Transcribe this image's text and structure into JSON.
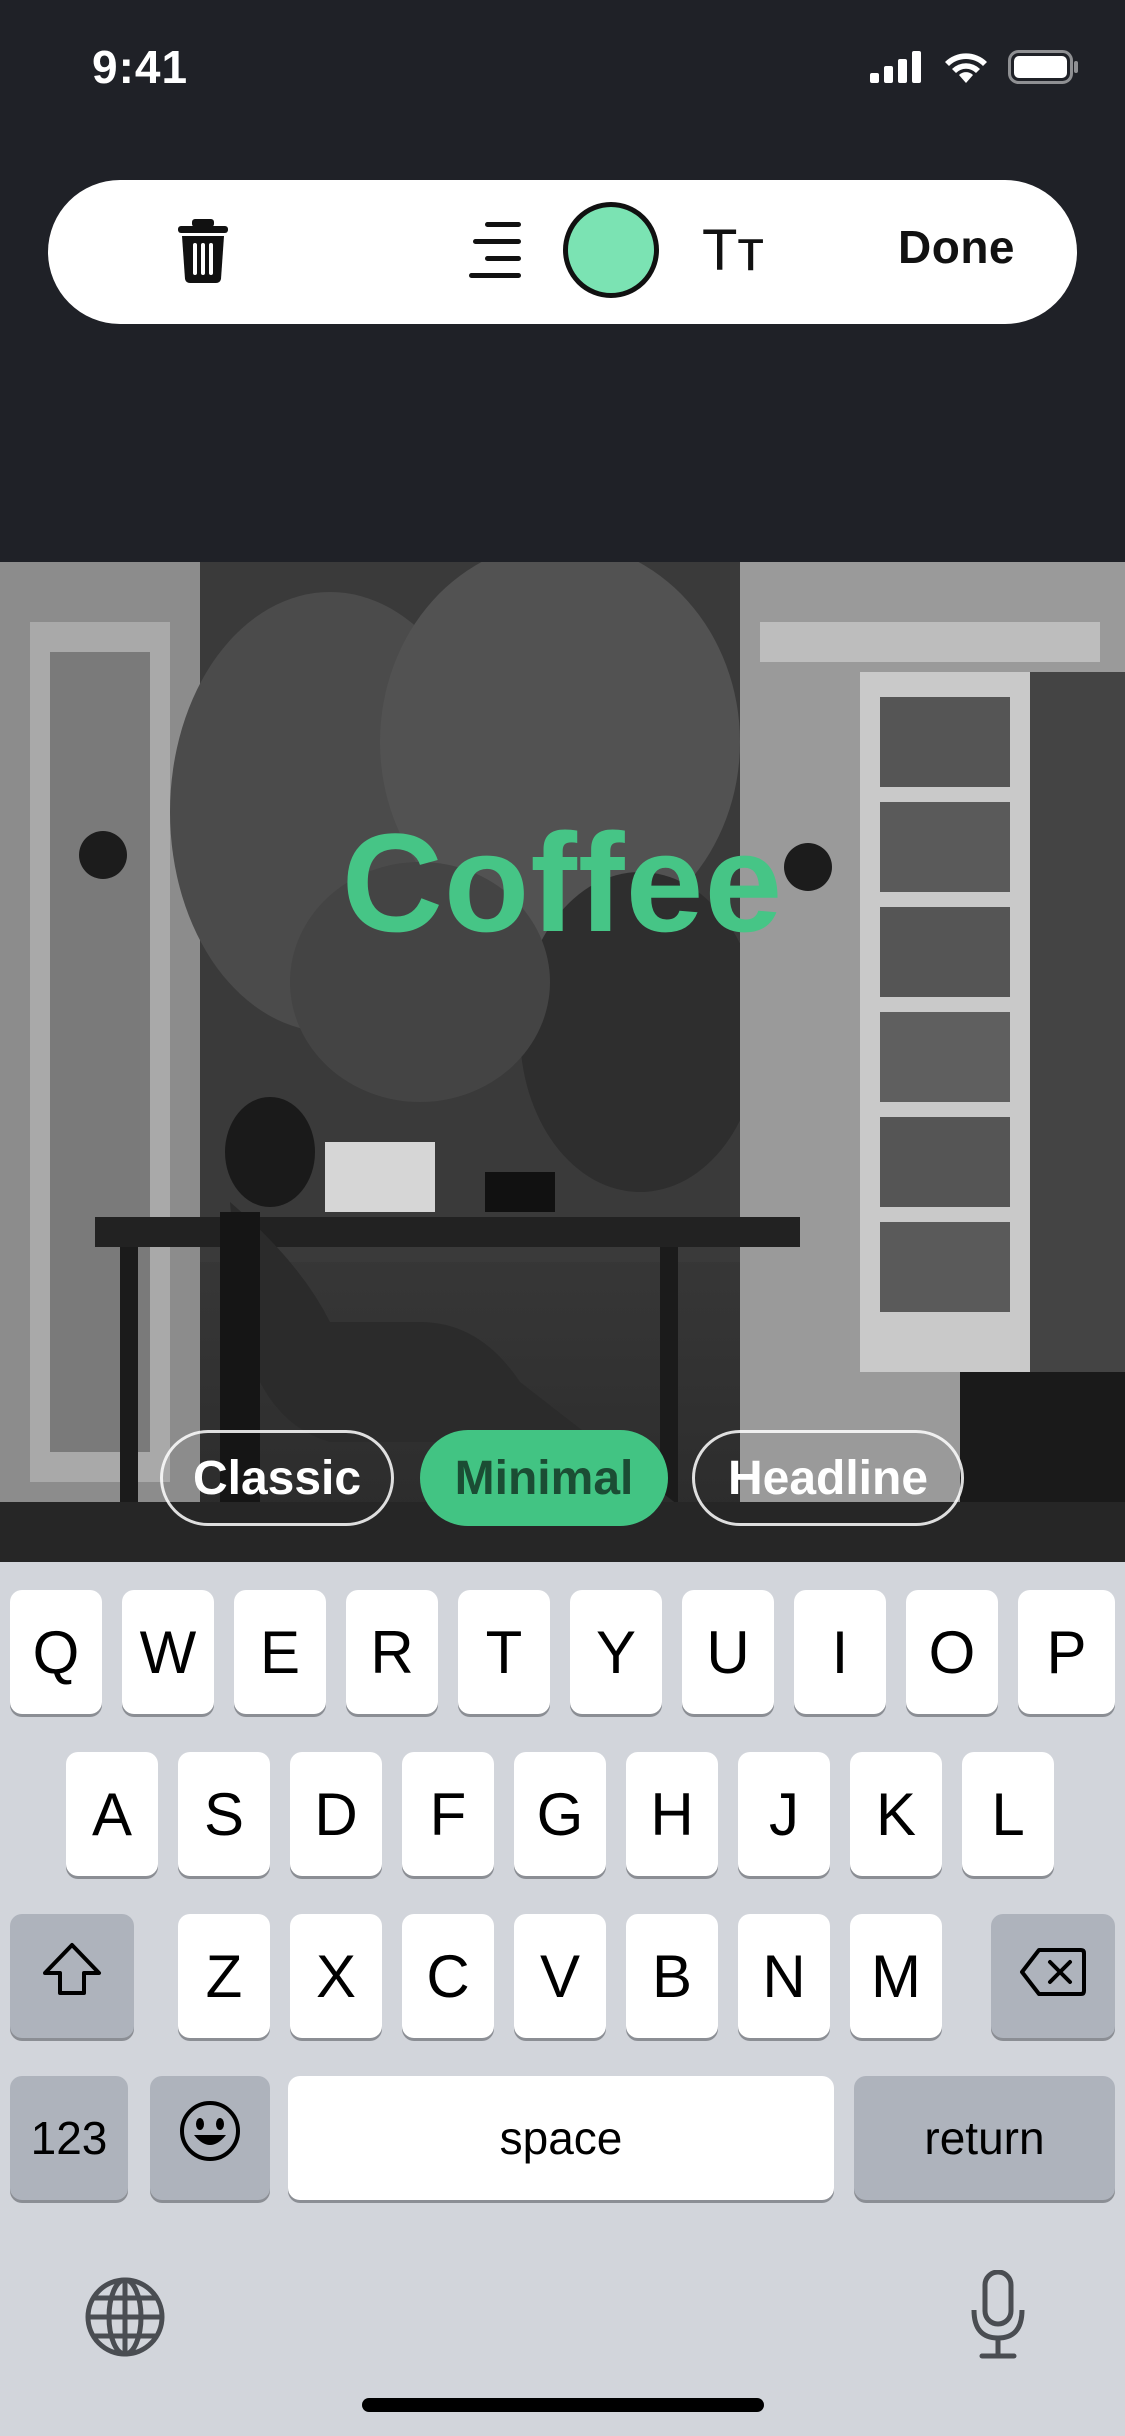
{
  "status_bar": {
    "time": "9:41"
  },
  "toolbar": {
    "done_label": "Done",
    "text_size_glyph": "Tт",
    "swatch_color": "#7be3b3"
  },
  "canvas": {
    "overlay_text": "Coffee",
    "overlay_color": "#46c586"
  },
  "style_options": {
    "items": [
      {
        "label": "Classic",
        "selected": false
      },
      {
        "label": "Minimal",
        "selected": true
      },
      {
        "label": "Headline",
        "selected": false
      }
    ],
    "selected_color": "#42c483"
  },
  "keyboard": {
    "row1": [
      "Q",
      "W",
      "E",
      "R",
      "T",
      "Y",
      "U",
      "I",
      "O",
      "P"
    ],
    "row2": [
      "A",
      "S",
      "D",
      "F",
      "G",
      "H",
      "J",
      "K",
      "L"
    ],
    "row3": [
      "Z",
      "X",
      "C",
      "V",
      "B",
      "N",
      "M"
    ],
    "numbers_label": "123",
    "space_label": "space",
    "return_label": "return"
  }
}
